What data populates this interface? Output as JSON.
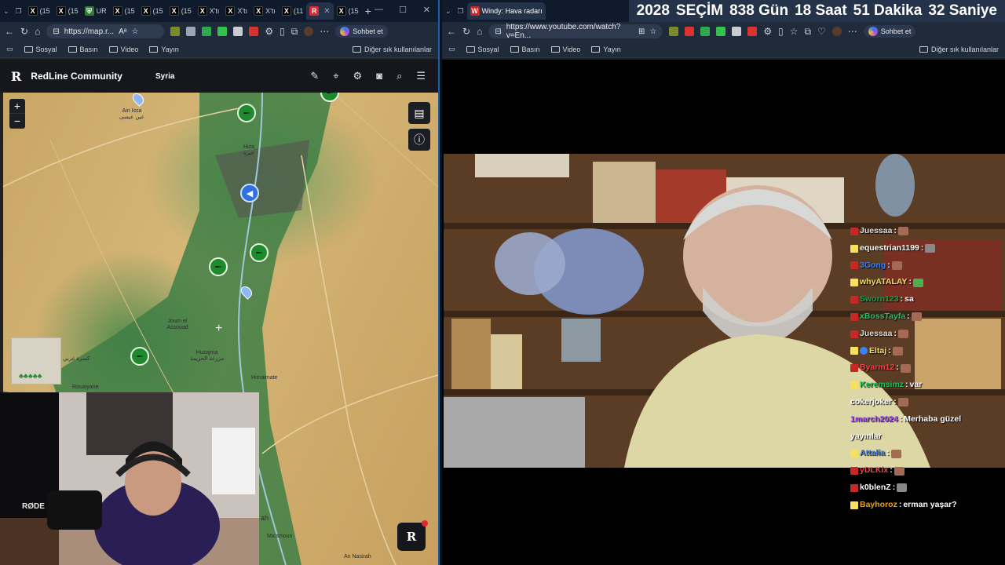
{
  "left_browser": {
    "tabs": [
      {
        "label": "(15",
        "icon": "x-logo"
      },
      {
        "label": "(15",
        "icon": "x-logo"
      },
      {
        "label": "UR",
        "icon": "shield-icon"
      },
      {
        "label": "(15",
        "icon": "x-logo"
      },
      {
        "label": "(15",
        "icon": "x-logo"
      },
      {
        "label": "(15",
        "icon": "x-logo"
      },
      {
        "label": "X'tı",
        "icon": "x-logo"
      },
      {
        "label": "X'tı",
        "icon": "x-logo"
      },
      {
        "label": "X'tı",
        "icon": "x-logo"
      },
      {
        "label": "(11",
        "icon": "x-logo"
      },
      {
        "label": "",
        "icon": "redline-logo",
        "active": true
      },
      {
        "label": "(15",
        "icon": "x-logo"
      }
    ],
    "url": "https://map.r...",
    "chat_button": "Sohbet et",
    "bookmarks": [
      "Sosyal",
      "Basın",
      "Video",
      "Yayın"
    ],
    "bookmarks_other": "Diğer sık kullanılanlar"
  },
  "redline": {
    "logo": "R",
    "title": "RedLine Community",
    "region": "Syria",
    "header_icons": [
      "pen-icon",
      "location-pin-icon",
      "gear-icon",
      "camera-icon",
      "search-icon",
      "menu-icon"
    ],
    "zoom_in": "+",
    "zoom_out": "−",
    "fab_logo": "R",
    "places": [
      {
        "name": "Ain Issa",
        "sub": "عين عيسى"
      },
      {
        "name": "Hiza",
        "sub": "حيزة"
      },
      {
        "name": "Journ el Assouad",
        "sub": ""
      },
      {
        "name": "Huzajma",
        "sub": "مزرعة الحزيمة"
      },
      {
        "name": "Himaimate",
        "sub": ""
      },
      {
        "name": "Rouaiyane",
        "sub": ""
      },
      {
        "name": "Ma'amoun",
        "sub": ""
      },
      {
        "name": "An Nasirah",
        "sub": ""
      },
      {
        "name": "ah",
        "sub": ""
      },
      {
        "name": "Kisra",
        "sub": "كسرة غربي"
      }
    ]
  },
  "right_browser": {
    "tab_label": "Windy: Hava radarı",
    "url": "https://www.youtube.com/watch?v=En...",
    "chat_button": "Sohbet et",
    "bookmarks": [
      "Sosyal",
      "Basın",
      "Video",
      "Yayın"
    ],
    "bookmarks_other": "Diğer sık kullanılanlar"
  },
  "countdown": {
    "year": "2028",
    "label": "SEÇİM",
    "days": "838 Gün",
    "hours": "18 Saat",
    "minutes": "51 Dakika",
    "seconds": "32 Saniye"
  },
  "chat": [
    {
      "user": "Juessaa",
      "msg": "",
      "color": "#d9d9d9"
    },
    {
      "user": "equestrian1199",
      "msg": "",
      "color": "#ffffff"
    },
    {
      "user": "3Gong",
      "msg": "",
      "color": "#3b82f6"
    },
    {
      "user": "whyATALAY",
      "msg": "",
      "color": "#f6e05e"
    },
    {
      "user": "Sworn123",
      "msg": "sa",
      "color": "#16a34a"
    },
    {
      "user": "xBossTayfa",
      "msg": "",
      "color": "#22c55e"
    },
    {
      "user": "Juessaa",
      "msg": "",
      "color": "#d9d9d9"
    },
    {
      "user": "Eltaj",
      "msg": "",
      "color": "#f6e05e"
    },
    {
      "user": "Byarm12",
      "msg": "",
      "color": "#ef4444"
    },
    {
      "user": "Keremsimz",
      "msg": "var",
      "color": "#22c55e"
    },
    {
      "user": "cokerjoker",
      "msg": "",
      "color": "#ffffff"
    },
    {
      "user": "1march2024",
      "msg": "Merhaba güzel",
      "color": "#a855f7"
    },
    {
      "user": "",
      "msg": "yayınlar",
      "color": "#ffffff"
    },
    {
      "user": "Attalia",
      "msg": "",
      "color": "#3b82f6"
    },
    {
      "user": "yDLKix",
      "msg": "",
      "color": "#ef4444"
    },
    {
      "user": "k0blenZ",
      "msg": "",
      "color": "#ffffff"
    },
    {
      "user": "Bayhoroz",
      "msg": "erman yaşar?",
      "color": "#f59e0b"
    }
  ]
}
